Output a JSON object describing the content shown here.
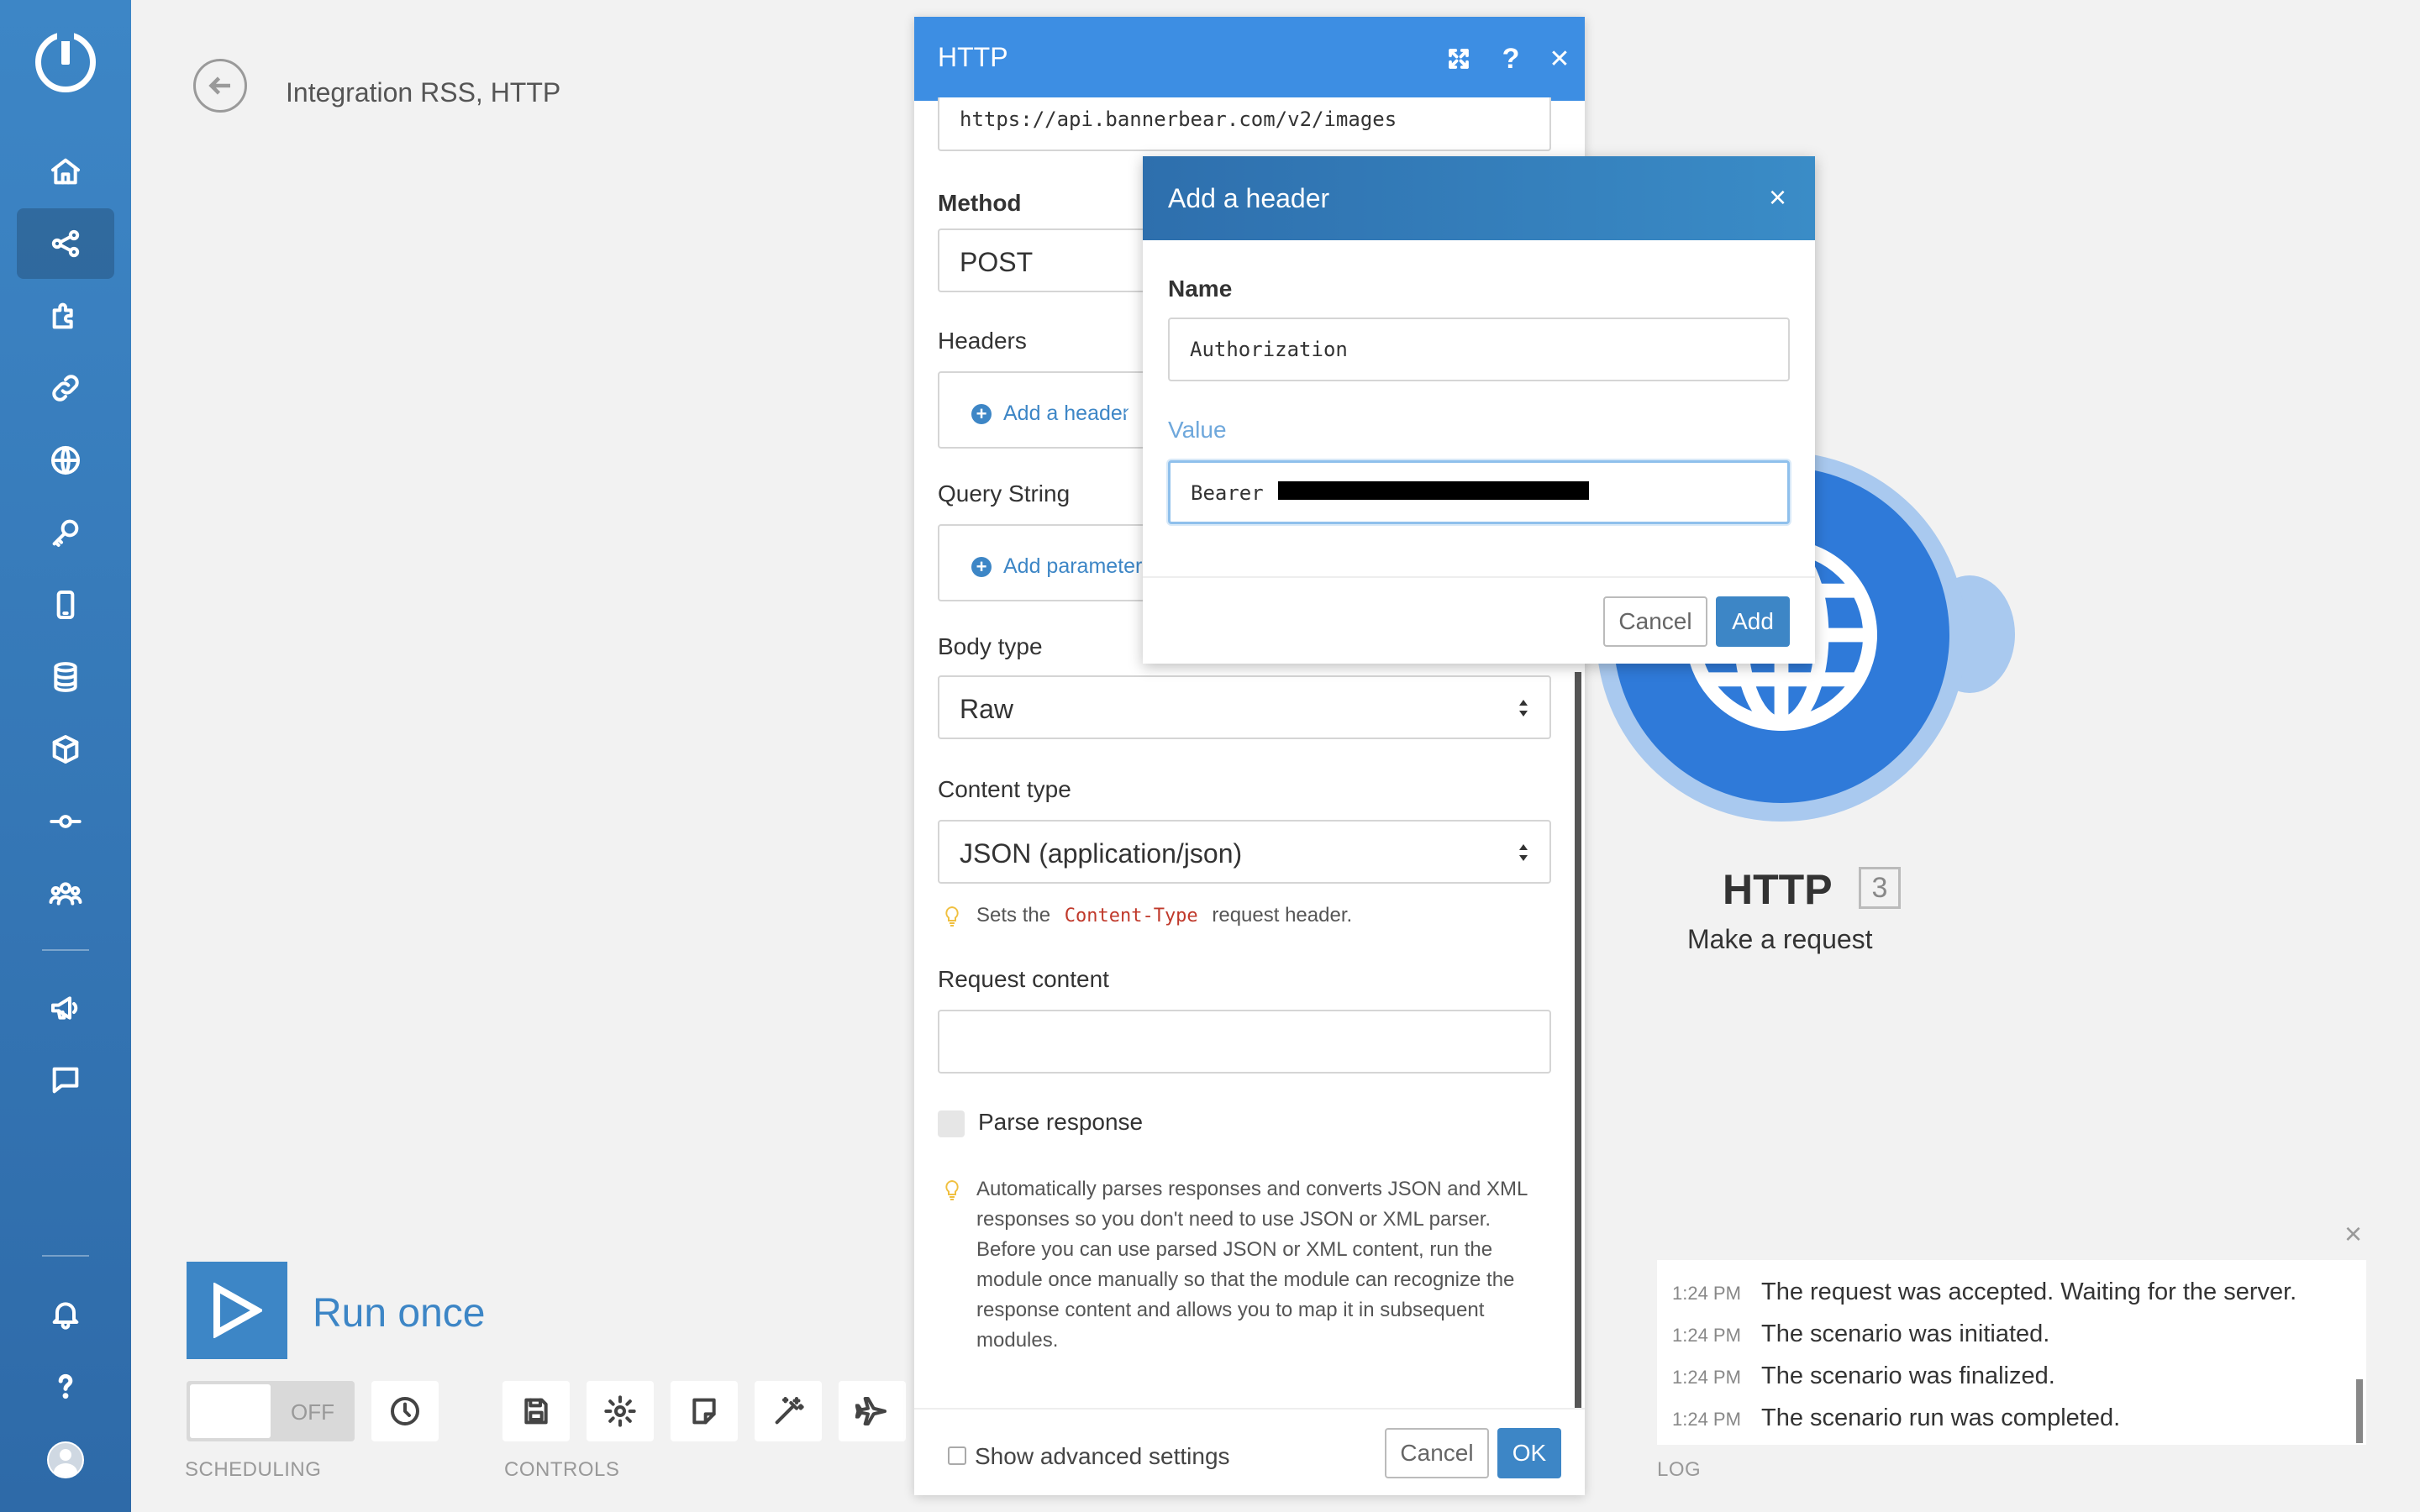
{
  "app": {
    "scenario_title": "Integration RSS, HTTP"
  },
  "sidebar": {
    "items": [
      {
        "icon": "home-icon",
        "active": false
      },
      {
        "icon": "share-icon",
        "active": true
      },
      {
        "icon": "puzzle-icon",
        "active": false
      },
      {
        "icon": "link-icon",
        "active": false
      },
      {
        "icon": "globe-icon",
        "active": false
      },
      {
        "icon": "key-icon",
        "active": false
      },
      {
        "icon": "mobile-icon",
        "active": false
      },
      {
        "icon": "database-icon",
        "active": false
      },
      {
        "icon": "cube-icon",
        "active": false
      },
      {
        "icon": "commit-icon",
        "active": false
      },
      {
        "icon": "team-icon",
        "active": false
      },
      {
        "icon": "megaphone-icon",
        "active": false
      },
      {
        "icon": "chat-icon",
        "active": false
      },
      {
        "icon": "bell-icon",
        "active": false
      },
      {
        "icon": "help-icon",
        "active": false
      }
    ],
    "accent": "#3d86c6"
  },
  "node": {
    "title": "HTTP",
    "badge": "3",
    "subtitle": "Make a request",
    "color": "#2f7ad9"
  },
  "toolbar": {
    "run_label": "Run once",
    "toggle_label": "OFF",
    "scheduling_label": "SCHEDULING",
    "controls_label": "CONTROLS",
    "log_label": "LOG"
  },
  "log": {
    "entries": [
      {
        "time": "1:24 PM",
        "message": "The request was accepted. Waiting for the server."
      },
      {
        "time": "1:24 PM",
        "message": "The scenario was initiated."
      },
      {
        "time": "1:24 PM",
        "message": "The scenario was finalized."
      },
      {
        "time": "1:24 PM",
        "message": "The scenario run was completed."
      }
    ]
  },
  "http_dialog": {
    "title": "HTTP",
    "url_value": "https://api.bannerbear.com/v2/images",
    "method_label": "Method",
    "method_value": "POST",
    "headers_label": "Headers",
    "add_header_link": "Add a header",
    "query_label": "Query String",
    "add_param_link": "Add parameter",
    "body_type_label": "Body type",
    "body_type_value": "Raw",
    "content_type_label": "Content type",
    "content_type_value": "JSON (application/json)",
    "content_hint_pre": "Sets the",
    "content_hint_code": "Content-Type",
    "content_hint_post": "request header.",
    "request_content_label": "Request content",
    "request_content_value": "",
    "parse_label": "Parse response",
    "parse_hint": "Automatically parses responses and converts JSON and XML responses so you don't need to use JSON or XML parser. Before you can use parsed JSON or XML content, run the module once manually so that the module can recognize the response content and allows you to map it in subsequent modules.",
    "advanced_label": "Show advanced settings",
    "cancel_label": "Cancel",
    "ok_label": "OK",
    "header_color": "#3d8ee3"
  },
  "header_dialog": {
    "title": "Add a header",
    "name_label": "Name",
    "name_value": "Authorization",
    "value_label": "Value",
    "value_prefix": "Bearer",
    "cancel_label": "Cancel",
    "add_label": "Add"
  }
}
